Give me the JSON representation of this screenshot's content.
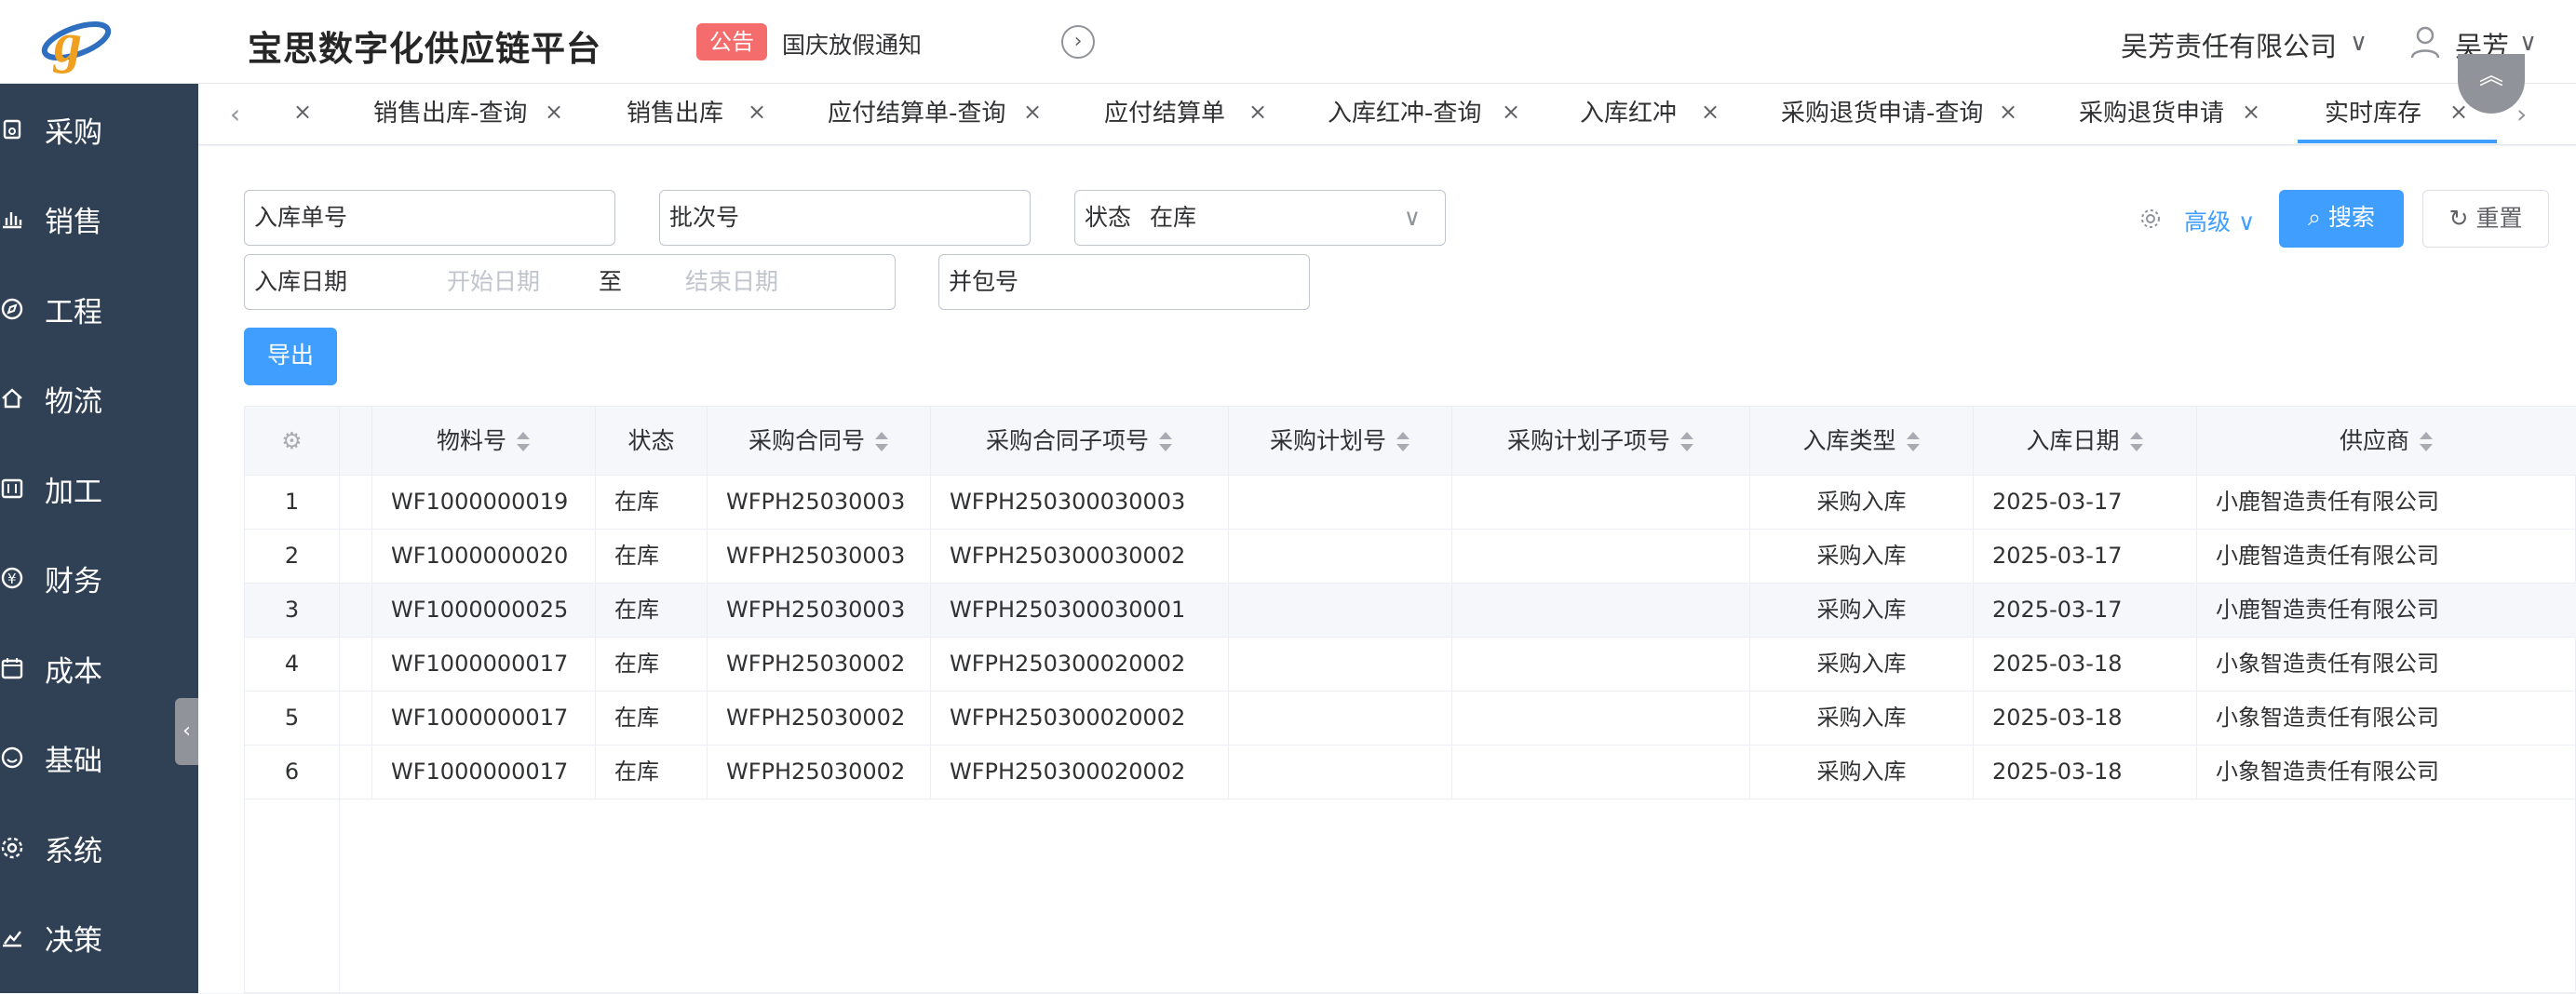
{
  "app": {
    "title": "宝思数字化供应链平台"
  },
  "notice": {
    "badge": "公告",
    "text": "国庆放假通知"
  },
  "user": {
    "company": "吴芳责任有限公司",
    "name": "吴芳"
  },
  "sidebar": {
    "items": [
      {
        "label": "采购",
        "icon": "purchase-icon"
      },
      {
        "label": "销售",
        "icon": "sales-chart-icon"
      },
      {
        "label": "工程",
        "icon": "compass-icon"
      },
      {
        "label": "物流",
        "icon": "home-icon"
      },
      {
        "label": "加工",
        "icon": "process-icon"
      },
      {
        "label": "财务",
        "icon": "yen-icon"
      },
      {
        "label": "成本",
        "icon": "calendar-icon"
      },
      {
        "label": "基础",
        "icon": "smile-icon"
      },
      {
        "label": "系统",
        "icon": "gear-icon"
      },
      {
        "label": "决策",
        "icon": "decision-chart-icon"
      }
    ]
  },
  "tabs": [
    {
      "label": "销售出库-查询"
    },
    {
      "label": "销售出库"
    },
    {
      "label": "应付结算单-查询"
    },
    {
      "label": "应付结算单"
    },
    {
      "label": "入库红冲-查询"
    },
    {
      "label": "入库红冲"
    },
    {
      "label": "采购退货申请-查询"
    },
    {
      "label": "采购退货申请"
    },
    {
      "label": "实时库存"
    }
  ],
  "search": {
    "receipt_no": "入库单号",
    "batch_no": "批次号",
    "status_label": "状态",
    "status_value": "在库",
    "date_label": "入库日期",
    "start_placeholder": "开始日期",
    "date_sep": "至",
    "end_placeholder": "结束日期",
    "bundle_no": "并包号",
    "advanced": "高级",
    "search_btn": "搜索",
    "reset_btn": "重置",
    "export_btn": "导出"
  },
  "table": {
    "columns": [
      "物料号",
      "状态",
      "采购合同号",
      "采购合同子项号",
      "采购计划号",
      "采购计划子项号",
      "入库类型",
      "入库日期",
      "供应商"
    ],
    "rows": [
      {
        "idx": "1",
        "material": "WF1000000019",
        "status": "在库",
        "contract": "WFPH25030003",
        "contract_item": "WFPH250300030003",
        "plan": "",
        "plan_item": "",
        "type": "采购入库",
        "date": "2025-03-17",
        "supplier": "小鹿智造责任有限公司"
      },
      {
        "idx": "2",
        "material": "WF1000000020",
        "status": "在库",
        "contract": "WFPH25030003",
        "contract_item": "WFPH250300030002",
        "plan": "",
        "plan_item": "",
        "type": "采购入库",
        "date": "2025-03-17",
        "supplier": "小鹿智造责任有限公司"
      },
      {
        "idx": "3",
        "material": "WF1000000025",
        "status": "在库",
        "contract": "WFPH25030003",
        "contract_item": "WFPH250300030001",
        "plan": "",
        "plan_item": "",
        "type": "采购入库",
        "date": "2025-03-17",
        "supplier": "小鹿智造责任有限公司"
      },
      {
        "idx": "4",
        "material": "WF1000000017",
        "status": "在库",
        "contract": "WFPH25030002",
        "contract_item": "WFPH250300020002",
        "plan": "",
        "plan_item": "",
        "type": "采购入库",
        "date": "2025-03-18",
        "supplier": "小象智造责任有限公司"
      },
      {
        "idx": "5",
        "material": "WF1000000017",
        "status": "在库",
        "contract": "WFPH25030002",
        "contract_item": "WFPH250300020002",
        "plan": "",
        "plan_item": "",
        "type": "采购入库",
        "date": "2025-03-18",
        "supplier": "小象智造责任有限公司"
      },
      {
        "idx": "6",
        "material": "WF1000000017",
        "status": "在库",
        "contract": "WFPH25030002",
        "contract_item": "WFPH250300020002",
        "plan": "",
        "plan_item": "",
        "type": "采购入库",
        "date": "2025-03-18",
        "supplier": "小象智造责任有限公司"
      }
    ]
  },
  "colors": {
    "primary": "#409eff",
    "sidebar_bg": "#304156",
    "notice_badge": "#f56c6c"
  }
}
